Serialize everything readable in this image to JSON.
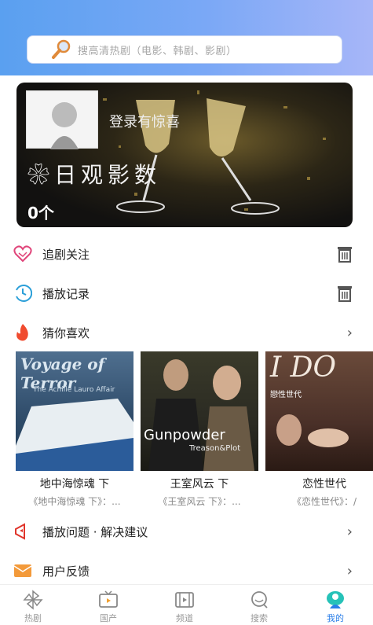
{
  "search": {
    "placeholder": "搜高清热剧（电影、韩剧、影剧）"
  },
  "banner": {
    "login_text": "登录有惊喜",
    "brand_text": "日观影数",
    "count": "0个"
  },
  "menu": {
    "follow": "追剧关注",
    "history": "播放记录",
    "recommend": "猜你喜欢",
    "issues": "播放问题 · 解决建议",
    "feedback": "用户反馈"
  },
  "recommendations": [
    {
      "title": "地中海惊魂 下",
      "subtitle": "《地中海惊魂 下》：...",
      "poster_text": "Voyage of Terror",
      "poster_sub": "The Achille Lauro Affair"
    },
    {
      "title": "王室风云 下",
      "subtitle": "《王室风云 下》：...",
      "poster_text": "Gunpowder",
      "poster_sub": "Treason&Plot"
    },
    {
      "title": "恋性世代",
      "subtitle": "《恋性世代》：/",
      "poster_text": "I DO",
      "poster_sub": "戀性世代"
    }
  ],
  "tabs": [
    {
      "label": "热剧",
      "icon": "pinwheel-icon"
    },
    {
      "label": "国产",
      "icon": "tv-icon"
    },
    {
      "label": "频道",
      "icon": "film-icon"
    },
    {
      "label": "搜索",
      "icon": "search-bubble-icon"
    },
    {
      "label": "我的",
      "icon": "profile-icon",
      "active": true
    }
  ],
  "colors": {
    "accent": "#2b7fe8",
    "header_start": "#5aa0f0",
    "header_end": "#a7b6f8"
  }
}
